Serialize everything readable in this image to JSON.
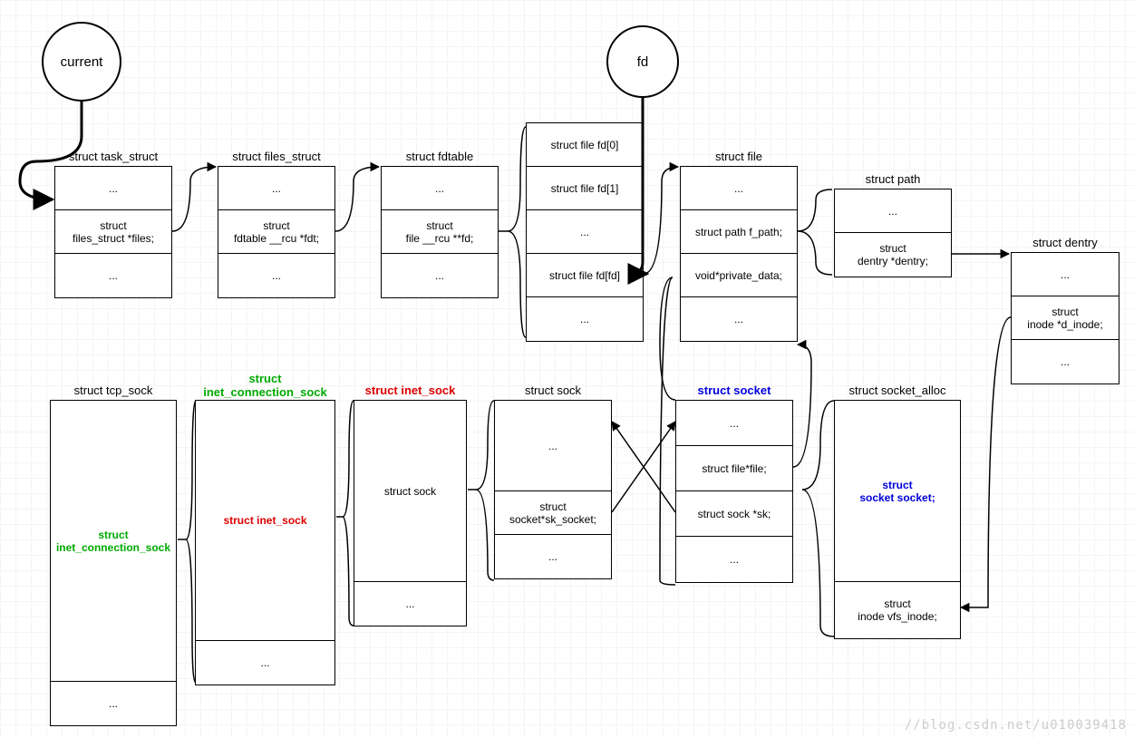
{
  "circles": {
    "current": "current",
    "fd": "fd"
  },
  "task_struct": {
    "title": "struct task_struct",
    "r0": "...",
    "r1": "struct\nfiles_struct *files;",
    "r2": "..."
  },
  "files_struct": {
    "title": "struct files_struct",
    "r0": "...",
    "r1": "struct\nfdtable __rcu *fdt;",
    "r2": "..."
  },
  "fdtable": {
    "title": "struct fdtable",
    "r0": "...",
    "r1": "struct\nfile __rcu **fd;",
    "r2": "..."
  },
  "file_array": {
    "r0": "struct file fd[0]",
    "r1": "struct file fd[1]",
    "r2": "...",
    "r3": "struct file fd[fd]",
    "r4": "..."
  },
  "file": {
    "title": "struct file",
    "r0": "...",
    "r1": "struct path f_path;",
    "r2": "void*private_data;",
    "r3": "..."
  },
  "path": {
    "title": "struct path",
    "r0": "...",
    "r1": "struct\ndentry *dentry;"
  },
  "dentry": {
    "title": "struct dentry",
    "r0": "...",
    "r1": "struct\ninode *d_inode;",
    "r2": "..."
  },
  "tcp_sock": {
    "title": "struct tcp_sock",
    "r0": "struct\ninet_connection_sock",
    "r1": "..."
  },
  "icsock": {
    "title": "struct\ninet_connection_sock",
    "r0": "struct inet_sock",
    "r1": "..."
  },
  "inet_sock": {
    "title": "struct inet_sock",
    "r0": "struct sock",
    "r1": "..."
  },
  "sock": {
    "title": "struct sock",
    "r0": "...",
    "r1": "struct\nsocket*sk_socket;",
    "r2": "..."
  },
  "socket": {
    "title": "struct socket",
    "r0": "...",
    "r1": "struct file*file;",
    "r2": "struct sock *sk;",
    "r3": "..."
  },
  "socket_alloc": {
    "title": "struct socket_alloc",
    "r0": "struct\nsocket socket;",
    "r1": "struct\ninode vfs_inode;"
  },
  "watermark": "//blog.csdn.net/u010039418"
}
